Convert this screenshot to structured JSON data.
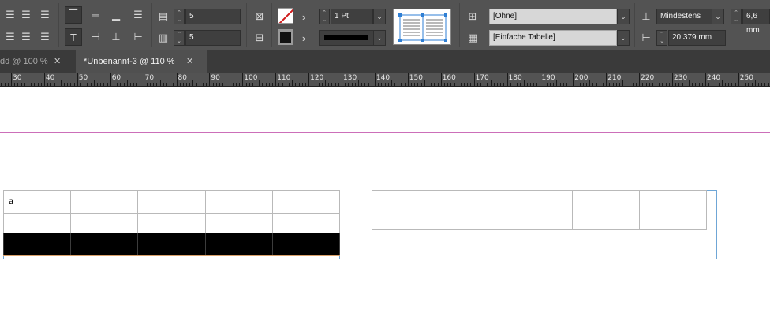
{
  "toolbar": {
    "rows_value": "5",
    "cols_value": "5",
    "stroke_weight": "1 Pt",
    "cell_style": "[Ohne]",
    "table_style": "[Einfache Tabelle]",
    "row_height_mode": "Mindestens",
    "row_height_value": "6,6 mm",
    "col_width_value": "20,379 mm"
  },
  "tabs": [
    {
      "label": "dd @ 100 %",
      "active": false
    },
    {
      "label": "*Unbenannt-3 @ 110 %",
      "active": true
    }
  ],
  "ruler": {
    "labels": [
      "30",
      "40",
      "50",
      "60",
      "70",
      "80",
      "90",
      "100",
      "110",
      "120",
      "130",
      "140",
      "150",
      "160",
      "170",
      "180",
      "190",
      "200",
      "210",
      "220",
      "230",
      "240",
      "250"
    ]
  },
  "document": {
    "table1_cell_text": "a"
  },
  "colors": {
    "margin_guide": "#cc6fb9",
    "frame_edge": "#6fa6d6",
    "ui_dark": "#535353"
  }
}
